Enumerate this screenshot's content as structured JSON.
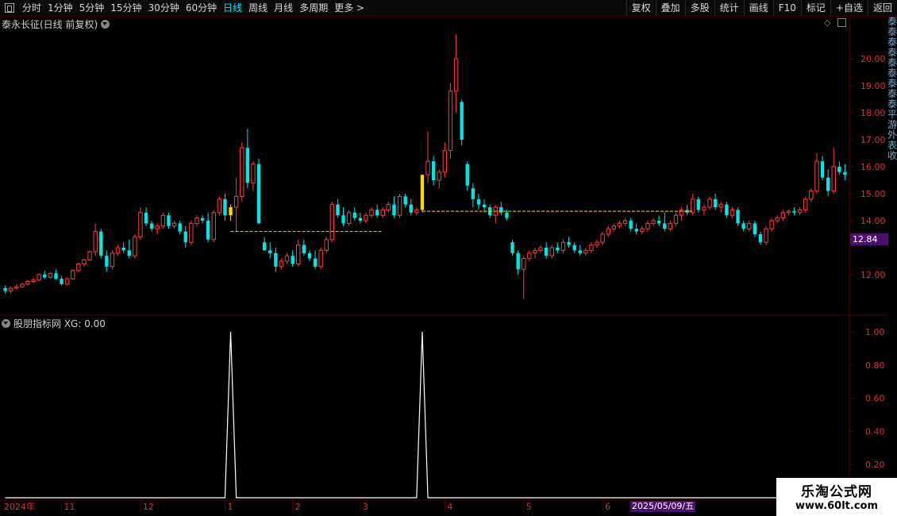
{
  "toolbar": {
    "periods": [
      "分时",
      "1分钟",
      "5分钟",
      "15分钟",
      "30分钟",
      "60分钟",
      "日线",
      "周线",
      "月线",
      "多周期",
      "更多 >"
    ],
    "active_index": 6,
    "actions": [
      "复权",
      "叠加",
      "多股",
      "统计",
      "画线",
      "F10",
      "标记",
      "+自选",
      "返回"
    ]
  },
  "main_panel": {
    "title": "泰永长征(日线 前复权)",
    "yticks": [
      "20.00",
      "19.00",
      "18.00",
      "17.00",
      "16.00",
      "15.00",
      "14.00",
      "12.00"
    ],
    "current_price": "12.84"
  },
  "indicator_panel": {
    "title": "股朋指标网  XG: 0.00",
    "yticks": [
      "1.00",
      "0.80",
      "0.60",
      "0.40",
      "0.20"
    ]
  },
  "xaxis": {
    "labels": [
      "2024年",
      "11",
      "12",
      "1",
      "2",
      "3",
      "4",
      "5",
      "6"
    ],
    "highlight_date": "2025/05/09/五"
  },
  "watermark": {
    "line1": "乐淘公式网",
    "line2": "www.60lt.com"
  },
  "right_strip_text": "泰泰泰泰泰泰泰泰泰平游外表收",
  "colors": {
    "up": "#ff3c3c",
    "down": "#00e5e5",
    "signal": "#ffd700",
    "indicator": "#ffffff",
    "grid": "#5a0000"
  },
  "chart_data": {
    "type": "candlestick",
    "ylim": [
      11,
      21
    ],
    "candles": [
      [
        11.5,
        11.6,
        11.3,
        11.4
      ],
      [
        11.4,
        11.55,
        11.3,
        11.5
      ],
      [
        11.5,
        11.65,
        11.45,
        11.55
      ],
      [
        11.55,
        11.7,
        11.5,
        11.65
      ],
      [
        11.65,
        11.8,
        11.6,
        11.75
      ],
      [
        11.75,
        11.9,
        11.7,
        11.8
      ],
      [
        11.8,
        12.05,
        11.75,
        12.0
      ],
      [
        12.0,
        12.15,
        11.85,
        11.9
      ],
      [
        11.9,
        12.1,
        11.85,
        12.05
      ],
      [
        12.05,
        12.2,
        11.8,
        11.85
      ],
      [
        11.85,
        11.95,
        11.6,
        11.65
      ],
      [
        11.65,
        11.9,
        11.6,
        11.85
      ],
      [
        11.85,
        12.2,
        11.8,
        12.15
      ],
      [
        12.15,
        12.45,
        12.1,
        12.4
      ],
      [
        12.4,
        12.6,
        12.3,
        12.55
      ],
      [
        12.55,
        12.9,
        12.5,
        12.85
      ],
      [
        12.85,
        13.9,
        12.7,
        13.6
      ],
      [
        13.6,
        13.7,
        12.6,
        12.7
      ],
      [
        12.7,
        12.9,
        12.1,
        12.3
      ],
      [
        12.3,
        12.9,
        12.2,
        12.8
      ],
      [
        12.8,
        13.1,
        12.7,
        13.0
      ],
      [
        13.0,
        13.2,
        12.8,
        12.9
      ],
      [
        12.9,
        13.3,
        12.6,
        12.7
      ],
      [
        12.7,
        13.5,
        12.6,
        13.4
      ],
      [
        13.4,
        14.5,
        13.3,
        14.3
      ],
      [
        14.3,
        14.5,
        13.8,
        13.9
      ],
      [
        13.9,
        14.0,
        13.6,
        13.7
      ],
      [
        13.7,
        13.9,
        13.5,
        13.8
      ],
      [
        13.8,
        14.3,
        13.7,
        14.2
      ],
      [
        14.2,
        14.3,
        13.7,
        13.8
      ],
      [
        13.8,
        14.0,
        13.7,
        13.9
      ],
      [
        13.9,
        14.0,
        13.5,
        13.6
      ],
      [
        13.6,
        13.8,
        13.0,
        13.2
      ],
      [
        13.2,
        14.0,
        13.1,
        13.9
      ],
      [
        13.9,
        14.2,
        13.8,
        14.1
      ],
      [
        14.1,
        14.2,
        13.9,
        14.0
      ],
      [
        14.0,
        14.3,
        13.2,
        13.3
      ],
      [
        13.3,
        14.4,
        13.2,
        14.3
      ],
      [
        14.3,
        14.9,
        14.2,
        14.8
      ],
      [
        14.8,
        15.0,
        14.0,
        14.2
      ],
      [
        14.2,
        14.6,
        14.0,
        14.5
      ],
      [
        14.5,
        15.6,
        13.6,
        14.9
      ],
      [
        14.9,
        16.9,
        14.7,
        16.7
      ],
      [
        16.7,
        17.4,
        15.2,
        15.4
      ],
      [
        15.4,
        16.2,
        15.1,
        16.1
      ],
      [
        16.1,
        16.3,
        13.9,
        13.9
      ],
      [
        13.2,
        13.4,
        12.9,
        12.9
      ],
      [
        12.9,
        13.2,
        12.6,
        12.8
      ],
      [
        12.8,
        13.0,
        12.1,
        12.3
      ],
      [
        12.3,
        12.6,
        12.2,
        12.5
      ],
      [
        12.5,
        12.8,
        12.4,
        12.7
      ],
      [
        12.7,
        12.9,
        12.3,
        12.4
      ],
      [
        12.4,
        13.3,
        12.3,
        13.1
      ],
      [
        13.1,
        13.3,
        12.7,
        12.8
      ],
      [
        12.8,
        12.9,
        12.5,
        12.6
      ],
      [
        12.6,
        12.9,
        12.2,
        12.3
      ],
      [
        12.3,
        13.0,
        12.2,
        12.9
      ],
      [
        12.9,
        13.4,
        12.8,
        13.3
      ],
      [
        13.3,
        14.7,
        13.2,
        14.6
      ],
      [
        14.6,
        14.8,
        14.1,
        14.2
      ],
      [
        14.2,
        14.5,
        13.8,
        13.9
      ],
      [
        13.9,
        14.4,
        13.8,
        14.3
      ],
      [
        14.3,
        14.5,
        14.0,
        14.1
      ],
      [
        14.1,
        14.3,
        13.9,
        14.0
      ],
      [
        14.0,
        14.3,
        13.9,
        14.2
      ],
      [
        14.2,
        14.5,
        14.1,
        14.4
      ],
      [
        14.4,
        14.6,
        14.1,
        14.2
      ],
      [
        14.2,
        14.5,
        14.1,
        14.4
      ],
      [
        14.4,
        14.7,
        14.3,
        14.6
      ],
      [
        14.6,
        14.9,
        14.1,
        14.2
      ],
      [
        14.2,
        15.0,
        14.1,
        14.9
      ],
      [
        14.9,
        15.0,
        14.5,
        14.6
      ],
      [
        14.6,
        14.8,
        14.2,
        14.3
      ],
      [
        14.3,
        14.5,
        14.2,
        14.4
      ],
      [
        14.4,
        15.7,
        14.3,
        15.7
      ],
      [
        15.7,
        17.3,
        15.4,
        16.2
      ],
      [
        16.2,
        16.4,
        15.3,
        15.5
      ],
      [
        15.5,
        15.9,
        15.2,
        15.8
      ],
      [
        15.8,
        16.9,
        15.6,
        16.6
      ],
      [
        16.6,
        19.1,
        16.3,
        18.8
      ],
      [
        18.8,
        20.9,
        18.0,
        20.0
      ],
      [
        18.4,
        18.5,
        16.8,
        17.0
      ],
      [
        16.1,
        16.2,
        15.1,
        15.3
      ],
      [
        15.2,
        15.4,
        14.5,
        14.8
      ],
      [
        14.8,
        15.0,
        14.4,
        14.6
      ],
      [
        14.6,
        14.8,
        14.3,
        14.5
      ],
      [
        14.5,
        14.6,
        14.1,
        14.2
      ],
      [
        14.2,
        14.6,
        13.9,
        14.5
      ],
      [
        14.5,
        14.7,
        14.2,
        14.3
      ],
      [
        14.3,
        14.4,
        14.0,
        14.1
      ],
      [
        13.2,
        13.3,
        12.7,
        12.8
      ],
      [
        12.8,
        12.9,
        12.0,
        12.2
      ],
      [
        12.2,
        12.7,
        11.1,
        12.6
      ],
      [
        12.6,
        12.9,
        12.5,
        12.8
      ],
      [
        12.8,
        13.0,
        12.6,
        12.9
      ],
      [
        12.9,
        13.1,
        12.8,
        13.0
      ],
      [
        13.0,
        13.2,
        12.6,
        12.7
      ],
      [
        12.7,
        13.1,
        12.6,
        13.0
      ],
      [
        13.0,
        13.2,
        12.8,
        12.9
      ],
      [
        12.9,
        13.3,
        12.8,
        13.2
      ],
      [
        13.2,
        13.4,
        13.0,
        13.1
      ],
      [
        13.1,
        13.2,
        12.8,
        12.9
      ],
      [
        12.9,
        13.1,
        12.7,
        12.8
      ],
      [
        12.8,
        13.0,
        12.7,
        12.9
      ],
      [
        12.9,
        13.2,
        12.8,
        13.1
      ],
      [
        13.1,
        13.3,
        13.0,
        13.2
      ],
      [
        13.2,
        13.6,
        13.1,
        13.5
      ],
      [
        13.5,
        13.8,
        13.4,
        13.7
      ],
      [
        13.7,
        13.9,
        13.6,
        13.8
      ],
      [
        13.8,
        14.0,
        13.7,
        13.9
      ],
      [
        13.9,
        14.1,
        13.8,
        14.0
      ],
      [
        14.0,
        14.1,
        13.6,
        13.7
      ],
      [
        13.7,
        13.9,
        13.5,
        13.6
      ],
      [
        13.6,
        13.8,
        13.5,
        13.7
      ],
      [
        13.7,
        14.0,
        13.6,
        13.9
      ],
      [
        13.9,
        14.1,
        13.8,
        14.0
      ],
      [
        14.0,
        14.2,
        13.8,
        13.9
      ],
      [
        13.9,
        14.3,
        13.6,
        13.7
      ],
      [
        13.7,
        14.0,
        13.6,
        13.9
      ],
      [
        13.9,
        14.3,
        13.8,
        14.2
      ],
      [
        14.2,
        14.5,
        14.0,
        14.4
      ],
      [
        14.4,
        14.6,
        14.2,
        14.3
      ],
      [
        14.3,
        15.0,
        14.2,
        14.8
      ],
      [
        14.8,
        14.9,
        14.3,
        14.4
      ],
      [
        14.4,
        14.6,
        14.2,
        14.5
      ],
      [
        14.5,
        14.9,
        14.4,
        14.8
      ],
      [
        14.8,
        15.0,
        14.4,
        14.5
      ],
      [
        14.5,
        14.7,
        14.3,
        14.6
      ],
      [
        14.6,
        14.7,
        14.1,
        14.2
      ],
      [
        14.2,
        14.5,
        14.1,
        14.4
      ],
      [
        14.4,
        14.5,
        13.8,
        13.9
      ],
      [
        13.9,
        14.0,
        13.6,
        13.7
      ],
      [
        13.7,
        14.0,
        13.6,
        13.9
      ],
      [
        13.9,
        14.0,
        13.4,
        13.5
      ],
      [
        13.5,
        13.6,
        13.1,
        13.2
      ],
      [
        13.2,
        13.8,
        13.1,
        13.7
      ],
      [
        13.7,
        14.1,
        13.6,
        14.0
      ],
      [
        14.0,
        14.2,
        13.9,
        14.1
      ],
      [
        14.1,
        14.4,
        14.0,
        14.3
      ],
      [
        14.3,
        14.4,
        14.2,
        14.35
      ],
      [
        14.35,
        14.5,
        14.2,
        14.3
      ],
      [
        14.3,
        14.5,
        14.2,
        14.4
      ],
      [
        14.4,
        14.9,
        14.3,
        14.8
      ],
      [
        14.8,
        15.2,
        14.7,
        15.1
      ],
      [
        15.1,
        16.5,
        15.0,
        16.2
      ],
      [
        16.2,
        16.4,
        15.5,
        15.6
      ],
      [
        15.6,
        15.9,
        14.9,
        15.1
      ],
      [
        15.1,
        16.7,
        15.0,
        16.0
      ],
      [
        16.0,
        16.2,
        15.7,
        15.8
      ],
      [
        15.8,
        16.1,
        15.5,
        15.7
      ]
    ],
    "signal_candles": [
      40,
      74
    ],
    "support_lines": [
      {
        "from": 40,
        "to": 67,
        "price": 13.6
      },
      {
        "from": 74,
        "to": 122,
        "price": 14.35
      }
    ],
    "indicator": {
      "type": "line",
      "values_at_signals": [
        1,
        1
      ],
      "baseline": 0
    },
    "xaxis_label_positions": [
      0,
      10,
      24,
      39,
      51,
      63,
      78,
      92,
      106
    ]
  }
}
